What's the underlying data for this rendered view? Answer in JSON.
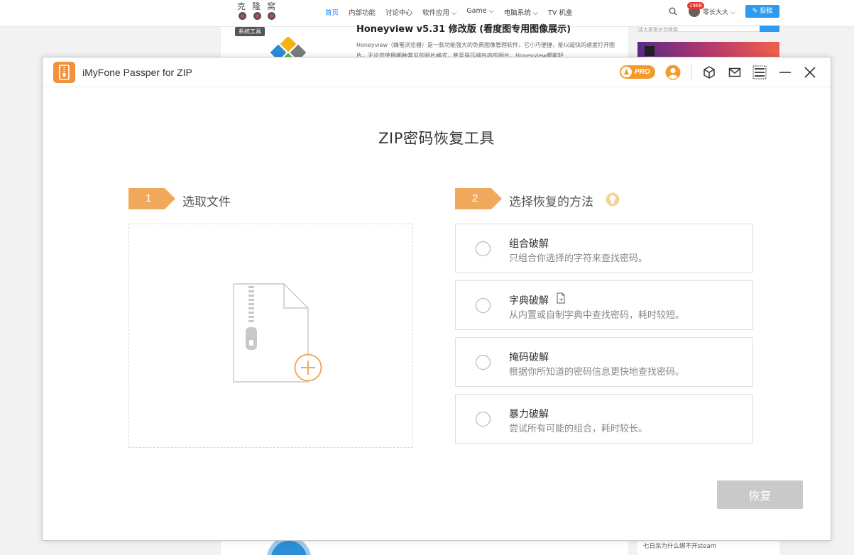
{
  "background_site": {
    "logo_text": "克隆窝",
    "menu": [
      "首页",
      "内部功能",
      "讨论中心",
      "软件应用 ⌵",
      "Game ⌵",
      "电脑系统 ⌵",
      "TV 机盒"
    ],
    "user_badge": "1968",
    "user_name": "零长大大 ⌵",
    "post_button": "✎ 投稿",
    "tag": "系统工具",
    "article_title": "Honeyview v5.31 修改版 (看度图专用图像展示)",
    "article_excerpt": "Honeyview（蜂蜜浏览器）是一款功能强大的免费图像管理软件，它小巧便捷，能以超快的速度打开图片。无论您使用哪种常见的图片格式，甚至是压缩包内的图片，Honeyview都能轻...",
    "side_input": "请大家爱护克隆窝",
    "side_item": "七日杀为什么绑不开steam",
    "colors": {
      "nav_active": "#1e88e5",
      "post_button": "#2f9bf0"
    }
  },
  "app": {
    "title": "iMyFone Passper for ZIP",
    "pro_label": "PRO",
    "icons": {
      "account": "account-icon",
      "package": "package-icon",
      "mail": "mail-icon",
      "menu": "menu-icon",
      "minimize": "minimize-icon",
      "close": "close-icon"
    },
    "page_title": "ZIP密码恢复工具",
    "step1": {
      "number": "1",
      "label": "选取文件"
    },
    "step2": {
      "number": "2",
      "label": "选择恢复的方法"
    },
    "methods": [
      {
        "name": "组合破解",
        "desc": "只组合你选择的字符来查找密码。"
      },
      {
        "name": "字典破解",
        "desc": "从内置或自制字典中查找密码，耗时较短。"
      },
      {
        "name": "掩码破解",
        "desc": "根据你所知道的密码信息更快地查找密码。"
      },
      {
        "name": "暴力破解",
        "desc": "尝试所有可能的组合，耗时较长。"
      }
    ],
    "recover_button": "恢复",
    "colors": {
      "accent": "#f0a95c",
      "pro_badge": "#f39a2c",
      "button_disabled": "#c9c9c9"
    }
  }
}
